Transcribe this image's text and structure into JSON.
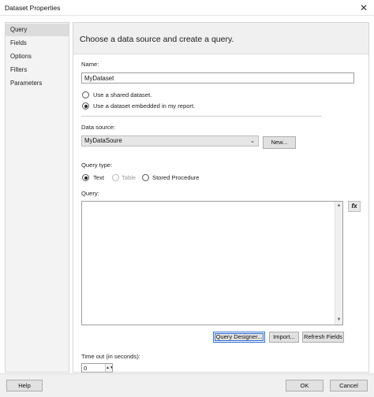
{
  "window": {
    "title": "Dataset Properties",
    "close_glyph": "✕"
  },
  "nav": {
    "items": [
      "Query",
      "Fields",
      "Options",
      "Filters",
      "Parameters"
    ],
    "selected": "Query"
  },
  "header": {
    "heading": "Choose a data source and create a query."
  },
  "name_field": {
    "label": "Name:",
    "value": "MyDataset"
  },
  "dataset_source": {
    "shared_label": "Use a shared dataset.",
    "embedded_label": "Use a dataset embedded in my report.",
    "selected": "embedded"
  },
  "data_source": {
    "label": "Data source:",
    "value": "MyDataSoure",
    "new_button": "New..."
  },
  "query_type": {
    "label": "Query type:",
    "options": [
      "Text",
      "Table",
      "Stored Procedure"
    ],
    "selected": "Text",
    "disabled": [
      "Table"
    ]
  },
  "query": {
    "label": "Query:",
    "value": "",
    "fx_label": "fx"
  },
  "query_buttons": {
    "designer": "Query Designer...",
    "import": "Import...",
    "refresh": "Refresh Fields"
  },
  "timeout": {
    "label": "Time out (in seconds):",
    "value": "0"
  },
  "footer": {
    "help": "Help",
    "ok": "OK",
    "cancel": "Cancel"
  }
}
